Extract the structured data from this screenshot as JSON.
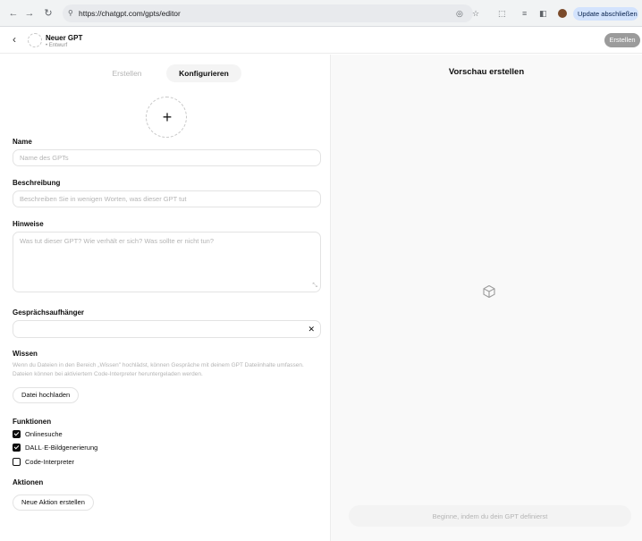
{
  "browser": {
    "url": "https://chatgpt.com/gpts/editor",
    "update_label": "Update abschließen"
  },
  "header": {
    "gpt_name": "Neuer GPT",
    "gpt_status": "• Entwurf",
    "create_label": "Erstellen"
  },
  "tabs": {
    "create": "Erstellen",
    "configure": "Konfigurieren"
  },
  "form": {
    "name_label": "Name",
    "name_placeholder": "Name des GPTs",
    "description_label": "Beschreibung",
    "description_placeholder": "Beschreiben Sie in wenigen Worten, was dieser GPT tut",
    "instructions_label": "Hinweise",
    "instructions_placeholder": "Was tut dieser GPT? Wie verhält er sich? Was sollte er nicht tun?",
    "starters_label": "Gesprächsaufhänger",
    "knowledge_label": "Wissen",
    "knowledge_desc": "Wenn du Dateien in den Bereich „Wissen\" hochlädst, können Gespräche mit deinem GPT Dateiinhalte umfassen. Dateien können bei aktiviertem Code-Interpreter heruntergeladen werden.",
    "upload_label": "Datei hochladen",
    "capabilities_label": "Funktionen",
    "capabilities": [
      {
        "label": "Onlinesuche",
        "checked": true
      },
      {
        "label": "DALL·E-Bildgenerierung",
        "checked": true
      },
      {
        "label": "Code-Interpreter",
        "checked": false
      }
    ],
    "actions_label": "Aktionen",
    "new_action_label": "Neue Aktion erstellen"
  },
  "preview": {
    "title": "Vorschau erstellen",
    "message_placeholder": "Beginne, indem du dein GPT definierst"
  }
}
